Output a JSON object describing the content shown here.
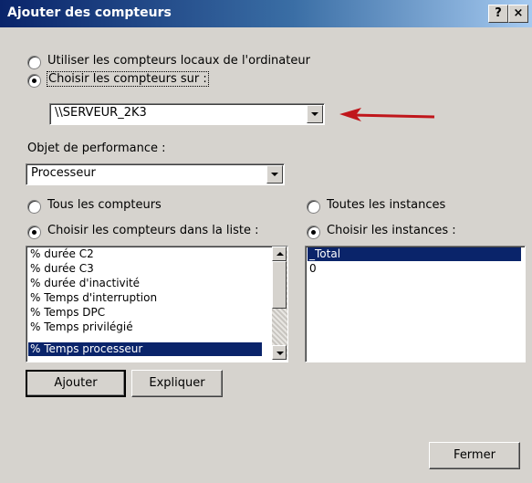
{
  "window": {
    "title": "Ajouter des compteurs",
    "help_button": "?",
    "close_button": "×"
  },
  "source": {
    "option_local": "Utiliser les compteurs locaux de l'ordinateur",
    "option_remote": "Choisir les compteurs sur :",
    "selected": "remote",
    "computer_value": "\\\\SERVEUR_2K3"
  },
  "performance_object": {
    "label": "Objet de performance :",
    "value": "Processeur"
  },
  "counters": {
    "option_all": "Tous les compteurs",
    "option_list": "Choisir les compteurs dans la liste :",
    "selected": "list",
    "items": [
      "% durée C2",
      "% durée C3",
      "% durée d'inactivité",
      "% Temps d'interruption",
      "% Temps DPC",
      "% Temps privilégié",
      "% Temps processeur"
    ],
    "selected_item": "% Temps processeur"
  },
  "instances": {
    "option_all": "Toutes les instances",
    "option_list": "Choisir les instances :",
    "selected": "list",
    "items": [
      "_Total",
      "0"
    ],
    "selected_item": "_Total"
  },
  "buttons": {
    "add": "Ajouter",
    "explain": "Expliquer",
    "close": "Fermer"
  },
  "annotation": {
    "arrow_color": "#c0161b"
  }
}
